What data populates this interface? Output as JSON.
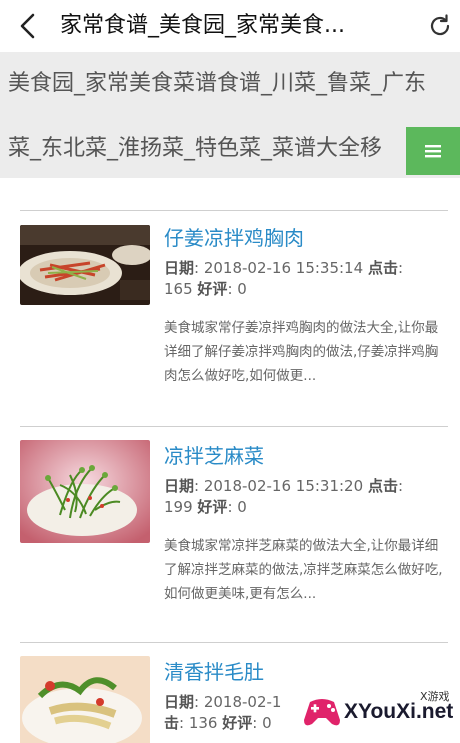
{
  "topbar": {
    "back_icon": "back-arrow-icon",
    "title": "家常食谱_美食园_家常美食...",
    "refresh_icon": "refresh-icon"
  },
  "subheader": {
    "line1": "美食园_家常美食菜谱食谱_川菜_鲁菜_广东",
    "line2": "菜_东北菜_淮扬菜_特色菜_菜谱大全移",
    "menu_icon": "hamburger-menu-icon",
    "menu_color": "#5cb85c"
  },
  "articles": [
    {
      "title": "仔姜凉拌鸡胸肉",
      "date_label": "日期",
      "date_value": ": 2018-02-16 15:35:14",
      "clicks_label": "点击",
      "clicks_value": ": 165",
      "rating_label": "好评",
      "rating_value": ": 0",
      "desc": "美食城家常仔姜凉拌鸡胸肉的做法大全,让你最详细了解仔姜凉拌鸡胸肉的做法,仔姜凉拌鸡胸肉怎么做好吃,如何做更..."
    },
    {
      "title": "凉拌芝麻菜",
      "date_label": "日期",
      "date_value": ": 2018-02-16 15:31:20",
      "clicks_label": "点击",
      "clicks_value": ": 199",
      "rating_label": "好评",
      "rating_value": ": 0",
      "desc": "美食城家常凉拌芝麻菜的做法大全,让你最详细了解凉拌芝麻菜的做法,凉拌芝麻菜怎么做好吃,如何做更美味,更有怎么..."
    },
    {
      "title": "清香拌毛肚",
      "date_label": "日期",
      "date_value": ": 2018-02-1",
      "clicks_label": "击",
      "clicks_value": ": 136",
      "rating_label": "好评",
      "rating_value": ": 0"
    }
  ],
  "watermark": {
    "main": "XYouXi.net",
    "small": "X游戏"
  },
  "colors": {
    "title_link": "#2a8bc7",
    "menu_button": "#5cb85c",
    "header_bg": "#ececec"
  }
}
